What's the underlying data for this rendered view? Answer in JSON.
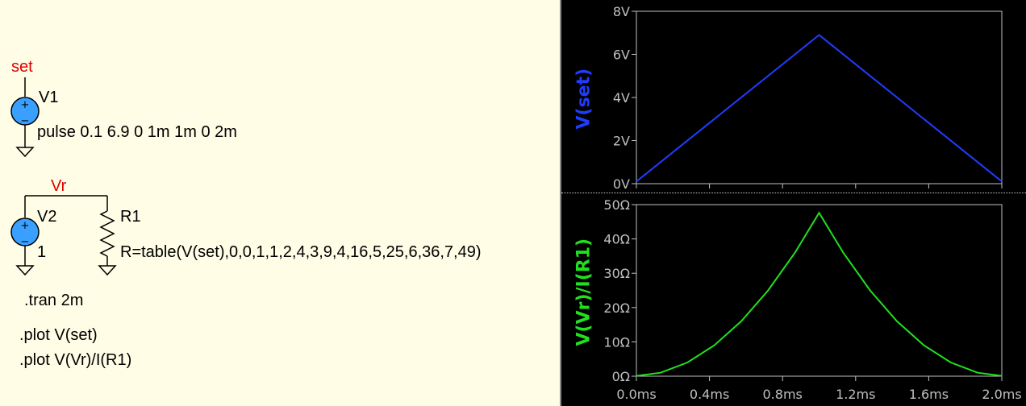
{
  "schematic": {
    "net_set": "set",
    "net_vr": "Vr",
    "v1_name": "V1",
    "v1_value": "pulse 0.1 6.9 0 1m 1m 0 2m",
    "v2_name": "V2",
    "v2_value": "1",
    "r1_name": "R1",
    "r1_value": "R=table(V(set),0,0,1,1,2,4,3,9,4,16,5,25,6,36,7,49)",
    "directive_tran": ".tran 2m",
    "directive_plot1": ".plot V(set)",
    "directive_plot2": ".plot V(Vr)/I(R1)"
  },
  "colors": {
    "schematic_bg": "#fffde6",
    "net_label": "#e00000",
    "source_body": "#1e90ff",
    "plot_bg": "#000000",
    "trace_set": "#1f3cff",
    "trace_r": "#21e01e",
    "axis": "#c0c0c0"
  },
  "chart_data": [
    {
      "type": "line",
      "title": "",
      "ylabel": "V(set)",
      "xlabel": "",
      "xlim": [
        0,
        2.0
      ],
      "ylim": [
        0,
        8
      ],
      "x_unit": "ms",
      "y_unit": "V",
      "yticks": [
        "0V",
        "2V",
        "4V",
        "6V",
        "8V"
      ],
      "grid": false,
      "series": [
        {
          "name": "V(set)",
          "x": [
            0,
            1.0,
            2.0
          ],
          "values": [
            0.1,
            6.9,
            0.1
          ]
        }
      ]
    },
    {
      "type": "line",
      "title": "",
      "ylabel": "V(Vr)/I(R1)",
      "xlabel": "",
      "xlim": [
        0,
        2.0
      ],
      "ylim": [
        0,
        50
      ],
      "x_unit": "ms",
      "y_unit": "Ω",
      "xticks": [
        "0.0ms",
        "0.4ms",
        "0.8ms",
        "1.2ms",
        "1.6ms",
        "2.0ms"
      ],
      "yticks": [
        "0Ω",
        "10Ω",
        "20Ω",
        "30Ω",
        "40Ω",
        "50Ω"
      ],
      "grid": false,
      "series": [
        {
          "name": "V(Vr)/I(R1)",
          "x": [
            0,
            0.132,
            0.279,
            0.426,
            0.574,
            0.721,
            0.868,
            1.0,
            1.132,
            1.279,
            1.426,
            1.574,
            1.721,
            1.868,
            2.0
          ],
          "values": [
            0.1,
            1,
            4,
            9,
            16,
            25,
            36,
            47.6,
            36,
            25,
            16,
            9,
            4,
            1,
            0.1
          ]
        }
      ]
    }
  ]
}
